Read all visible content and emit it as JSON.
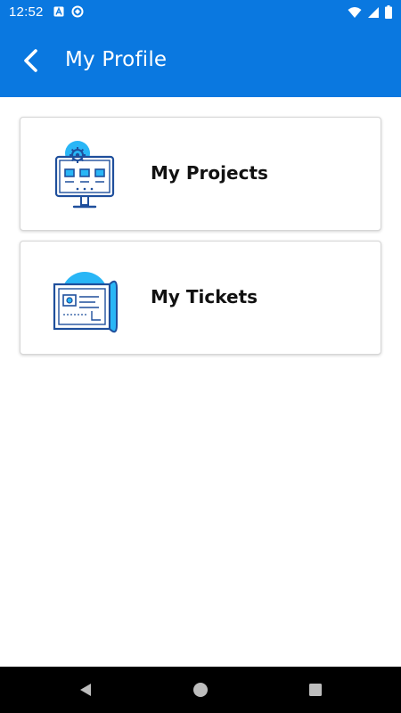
{
  "status_bar": {
    "time": "12:52",
    "icons": [
      "notification-a-icon",
      "sync-icon",
      "wifi-icon",
      "signal-icon",
      "battery-icon"
    ]
  },
  "app_bar": {
    "title": "My Profile",
    "back_icon": "back-arrow-icon"
  },
  "menu": {
    "items": [
      {
        "label": "My Projects",
        "icon": "projects-monitor-icon"
      },
      {
        "label": "My Tickets",
        "icon": "tickets-blueprint-icon"
      }
    ]
  },
  "nav_bar": {
    "buttons": [
      "back-triangle-icon",
      "home-circle-icon",
      "recents-square-icon"
    ]
  },
  "colors": {
    "primary": "#0a78e0",
    "icon_dark": "#1f4f9c",
    "icon_light": "#29b6f6"
  }
}
